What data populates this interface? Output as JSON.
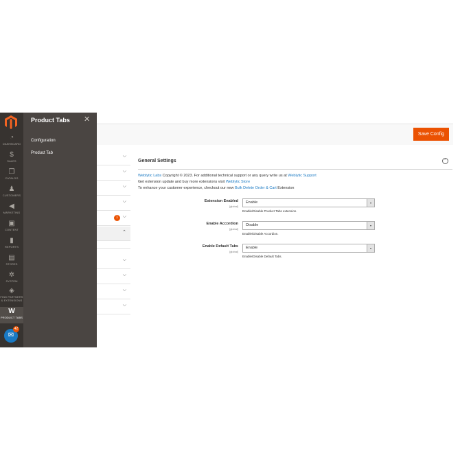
{
  "nav": {
    "items": [
      {
        "label": "Dashboard",
        "icon": "dashboard-icon",
        "glyph": "◔"
      },
      {
        "label": "Sales",
        "icon": "dollar-icon",
        "glyph": "$"
      },
      {
        "label": "Catalog",
        "icon": "cube-icon",
        "glyph": "❒"
      },
      {
        "label": "Customers",
        "icon": "person-icon",
        "glyph": "♟"
      },
      {
        "label": "Marketing",
        "icon": "megaphone-icon",
        "glyph": "◀"
      },
      {
        "label": "Content",
        "icon": "layout-icon",
        "glyph": "▣"
      },
      {
        "label": "Reports",
        "icon": "bar-chart-icon",
        "glyph": "▮"
      },
      {
        "label": "Stores",
        "icon": "store-icon",
        "glyph": "▤"
      },
      {
        "label": "System",
        "icon": "gear-icon",
        "glyph": "✲"
      },
      {
        "label": "Find Partners & Extensions",
        "icon": "box-icon",
        "glyph": "◈"
      },
      {
        "label": "Product Tabs",
        "icon": "weblytic-w-icon",
        "glyph": "W"
      }
    ],
    "fab_badge": "42"
  },
  "flyout": {
    "title": "Product Tabs",
    "links": [
      "Configuration",
      "Product Tab"
    ]
  },
  "header": {
    "save_label": "Save Config"
  },
  "tabs": {
    "badge": "1"
  },
  "section": {
    "title": "General Settings",
    "info": {
      "line1_link": "Weblytic Labs",
      "line1_text": " Copyright © 2023. For additional technical support or any query write us at ",
      "line1_link2": "Weblytic Support",
      "line2_text": "Get extension update and buy more extensions visit ",
      "line2_link": "Weblytic Store",
      "line3_text": "To enhance your customer experience, checkout our new ",
      "line3_link": "Bulk Delete Order & Cart",
      "line3_tail": " Extension"
    },
    "fields": [
      {
        "label": "Extension Enabled",
        "scope": "[global]",
        "value": "Enable",
        "note": "Enable/Disable Product Tabs extension."
      },
      {
        "label": "Enable Accordion",
        "scope": "[global]",
        "value": "Disable",
        "note": "Enable/Disable Accordion."
      },
      {
        "label": "Enable Default Tabs",
        "scope": "[global]",
        "value": "Enable",
        "note": "Enable/Disable Default Tabs."
      }
    ]
  }
}
